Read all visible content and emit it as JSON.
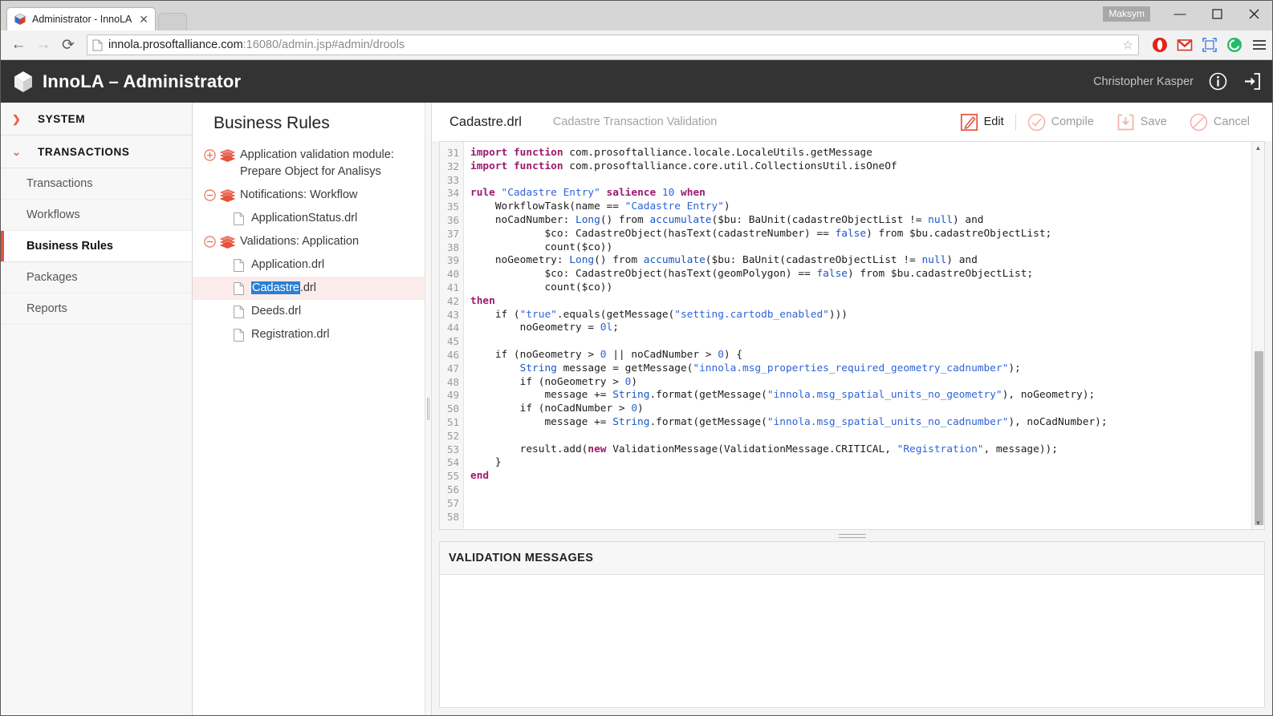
{
  "browser": {
    "tab": {
      "title": "Administrator - InnoLA",
      "favicon": "cube-favicon",
      "close": "✕"
    },
    "nav": {
      "back": "←",
      "forward": "→",
      "reload": "⟳"
    },
    "url": {
      "host": "innola.prosoftalliance.com",
      "rest": ":16080/admin.jsp#admin/drools"
    },
    "star": "☆",
    "extensions": [
      "opera-extension-icon",
      "gmail-icon",
      "screenshot-icon",
      "green-circle-icon"
    ],
    "window": {
      "user_chip": "Maksym",
      "minimize": "—",
      "maximize": "❐",
      "close": "✕"
    }
  },
  "header": {
    "logo": "cube-logo",
    "title": "InnoLA – Administrator",
    "username": "Christopher Kasper",
    "info_icon": "info-circle-icon",
    "logout_icon": "logout-icon"
  },
  "sidebar": {
    "groups": [
      {
        "label": "SYSTEM",
        "chevron": "❯",
        "expanded": false,
        "items": []
      },
      {
        "label": "TRANSACTIONS",
        "chevron": "⌄",
        "expanded": true,
        "items": [
          {
            "label": "Transactions",
            "active": false
          },
          {
            "label": "Workflows",
            "active": false
          },
          {
            "label": "Business Rules",
            "active": true
          },
          {
            "label": "Packages",
            "active": false
          },
          {
            "label": "Reports",
            "active": false
          }
        ]
      }
    ]
  },
  "tree": {
    "title": "Business Rules",
    "nodes": [
      {
        "kind": "folder",
        "toggle": "plus",
        "label": "Application validation module: Prepare Object for Analisys",
        "selected": false
      },
      {
        "kind": "folder",
        "toggle": "minus",
        "label": "Notifications: Workflow",
        "selected": false
      },
      {
        "kind": "file",
        "label": "ApplicationStatus.drl",
        "selected": false
      },
      {
        "kind": "folder",
        "toggle": "minus",
        "label": "Validations: Application",
        "selected": false
      },
      {
        "kind": "file",
        "label": "Application.drl",
        "selected": false
      },
      {
        "kind": "file",
        "label": "Cadastre.drl",
        "selected": true,
        "selection_text": "Cadastre",
        "selection_tail": ".drl"
      },
      {
        "kind": "file",
        "label": "Deeds.drl",
        "selected": false
      },
      {
        "kind": "file",
        "label": "Registration.drl",
        "selected": false
      }
    ]
  },
  "editor": {
    "doc_name": "Cadastre.drl",
    "doc_description": "Cadastre Transaction Validation",
    "actions": [
      {
        "label": "Edit",
        "icon": "edit-pencil-icon",
        "enabled": true
      },
      {
        "label": "Compile",
        "icon": "check-circle-icon",
        "enabled": false
      },
      {
        "label": "Save",
        "icon": "save-download-icon",
        "enabled": false
      },
      {
        "label": "Cancel",
        "icon": "cancel-circle-icon",
        "enabled": false
      }
    ],
    "first_line_number": 31,
    "last_line_number": 58,
    "lines": [
      "import function com.prosoftalliance.locale.LocaleUtils.getMessage",
      "import function com.prosoftalliance.core.util.CollectionsUtil.isOneOf",
      "",
      "rule \"Cadastre Entry\" salience 10 when",
      "    WorkflowTask(name == \"Cadastre Entry\")",
      "    noCadNumber: Long() from accumulate($bu: BaUnit(cadastreObjectList != null) and",
      "            $co: CadastreObject(hasText(cadastreNumber) == false) from $bu.cadastreObjectList;",
      "            count($co))",
      "    noGeometry: Long() from accumulate($bu: BaUnit(cadastreObjectList != null) and",
      "            $co: CadastreObject(hasText(geomPolygon) == false) from $bu.cadastreObjectList;",
      "            count($co))",
      "then",
      "    if (\"true\".equals(getMessage(\"setting.cartodb_enabled\")))",
      "        noGeometry = 0l;",
      "",
      "    if (noGeometry > 0 || noCadNumber > 0) {",
      "        String message = getMessage(\"innola.msg_properties_required_geometry_cadnumber\");",
      "        if (noGeometry > 0)",
      "            message += String.format(getMessage(\"innola.msg_spatial_units_no_geometry\"), noGeometry);",
      "        if (noCadNumber > 0)",
      "            message += String.format(getMessage(\"innola.msg_spatial_units_no_cadnumber\"), noCadNumber);",
      "",
      "        result.add(new ValidationMessage(ValidationMessage.CRITICAL, \"Registration\", message));",
      "    }",
      "end",
      "",
      "",
      ""
    ],
    "scrollbar": {
      "up_arrow": "▲",
      "down_arrow": "▼",
      "thumb_top_pct": 54,
      "thumb_height_pct": 45
    }
  },
  "validation": {
    "title": "VALIDATION MESSAGES",
    "messages": []
  },
  "colors": {
    "accent": "#e8503a",
    "header_bg": "#333333",
    "selection_blue": "#2a7fd4",
    "selected_row_bg": "#fbeceb",
    "keyword": "#9c1a6e",
    "type": "#1a56c4",
    "string": "#2f63d8"
  }
}
